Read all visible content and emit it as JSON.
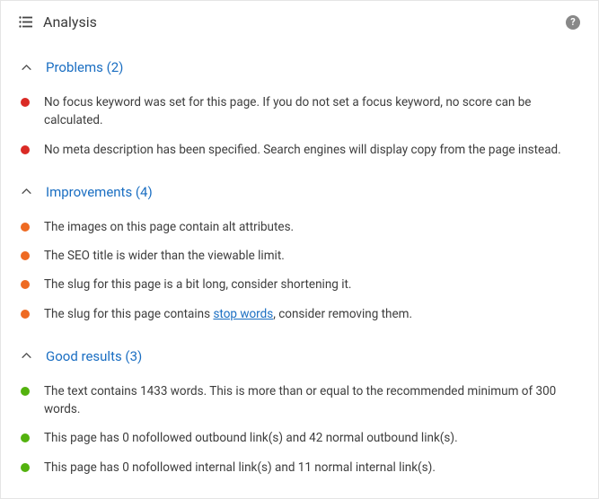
{
  "panel": {
    "title": "Analysis",
    "help_icon": "?"
  },
  "sections": [
    {
      "id": "problems",
      "title": "Problems (2)",
      "color": "red",
      "items": [
        {
          "text": "No focus keyword was set for this page. If you do not set a focus keyword, no score can be calculated."
        },
        {
          "text": "No meta description has been specified. Search engines will display copy from the page instead."
        }
      ]
    },
    {
      "id": "improvements",
      "title": "Improvements (4)",
      "color": "orange",
      "items": [
        {
          "text": "The images on this page contain alt attributes."
        },
        {
          "text": "The SEO title is wider than the viewable limit."
        },
        {
          "text": "The slug for this page is a bit long, consider shortening it."
        },
        {
          "text_before": "The slug for this page contains ",
          "link_text": "stop words",
          "text_after": ", consider removing them."
        }
      ]
    },
    {
      "id": "good",
      "title": "Good results (3)",
      "color": "green",
      "items": [
        {
          "text": "The text contains 1433 words. This is more than or equal to the recommended minimum of 300 words."
        },
        {
          "text": "This page has 0 nofollowed outbound link(s) and 42 normal outbound link(s)."
        },
        {
          "text": "This page has 0 nofollowed internal link(s) and 11 normal internal link(s)."
        }
      ]
    }
  ]
}
